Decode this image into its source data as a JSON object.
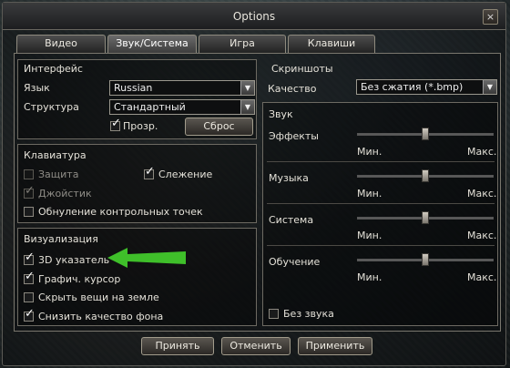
{
  "window": {
    "title": "Options",
    "close_glyph": "×"
  },
  "tabs": [
    {
      "label": "Видео",
      "active": false
    },
    {
      "label": "Звук/Система",
      "active": true
    },
    {
      "label": "Игра",
      "active": false
    },
    {
      "label": "Клавиши",
      "active": false
    }
  ],
  "interface": {
    "title": "Интерфейс",
    "language_label": "Язык",
    "language_value": "Russian",
    "structure_label": "Структура",
    "structure_value": "Стандартный",
    "transparency_label": "Прозр.",
    "transparency_checked": true,
    "reset_label": "Сброс"
  },
  "screenshots": {
    "title": "Скриншоты",
    "quality_label": "Качество",
    "quality_value": "Без сжатия (*.bmp)"
  },
  "keyboard": {
    "title": "Клавиатура",
    "protection_label": "Защита",
    "tracking_label": "Слежение",
    "joystick_label": "Джойстик",
    "reset_checkpoints_label": "Обнуление контрольных точек"
  },
  "visualization": {
    "title": "Визуализация",
    "items": [
      {
        "label": "3D указатель",
        "checked": true
      },
      {
        "label": "Графич. курсор",
        "checked": true
      },
      {
        "label": "Скрыть вещи на земле",
        "checked": false
      },
      {
        "label": "Снизить качество фона",
        "checked": true
      }
    ]
  },
  "sound": {
    "title": "Звук",
    "min_label": "Мин.",
    "max_label": "Макс.",
    "effects_label": "Эффекты",
    "music_label": "Музыка",
    "system_label": "Система",
    "tutorial_label": "Обучение",
    "levels": {
      "effects": 0.5,
      "music": 0.5,
      "system": 0.5,
      "tutorial": 0.5
    },
    "mute_label": "Без звука",
    "mute_checked": false
  },
  "footer": {
    "accept_label": "Принять",
    "cancel_label": "Отменить",
    "apply_label": "Применить"
  },
  "colors": {
    "highlight_arrow": "#3fbf2a"
  }
}
